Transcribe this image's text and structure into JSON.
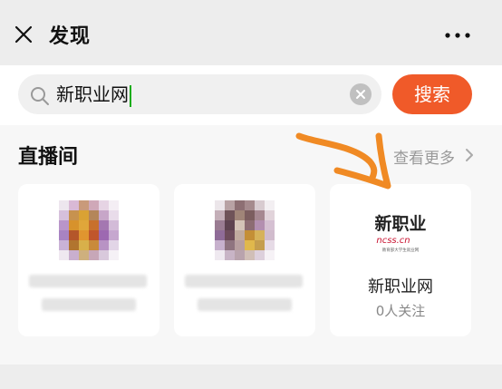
{
  "header": {
    "title": "发现",
    "close_icon": "close-icon",
    "more_icon": "more-dots-icon"
  },
  "search": {
    "query": "新职业网",
    "button_label": "搜索",
    "icon": "search-icon",
    "clear_icon": "clear-icon"
  },
  "live_section": {
    "title": "直播间",
    "see_more": "查看更多",
    "cards": [
      {
        "name": "",
        "followers": "",
        "avatar": "pixelated-avatar"
      },
      {
        "name": "",
        "followers": "",
        "avatar": "pixelated-avatar"
      },
      {
        "name": "新职业网",
        "followers": "0人关注",
        "logo_text": "新职业",
        "logo_sub": "ncss.cn",
        "logo_caption": "教育部大学生就业网"
      }
    ]
  },
  "colors": {
    "accent": "#f05a29",
    "logo_red": "#c8102e",
    "annotation_orange": "#f08a24"
  }
}
